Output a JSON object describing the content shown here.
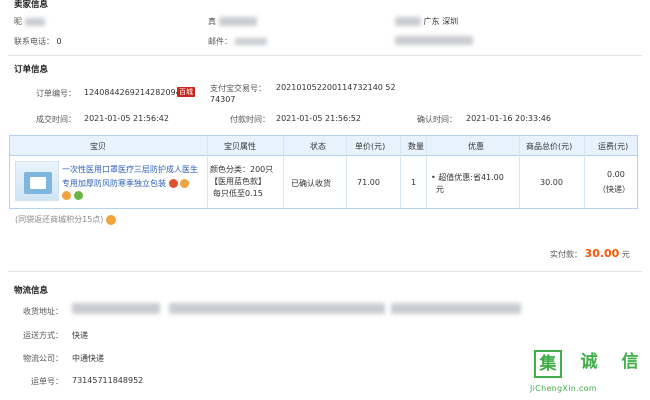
{
  "seller_info": {
    "title": "卖家信息",
    "row1_prefix": "昵",
    "row1_mid_prefix": "真",
    "row1_right_tail": "广东 深圳",
    "phone_label": "联系电话：",
    "phone_tail": "0",
    "email_label": "邮件："
  },
  "order_info": {
    "title": "订单信息",
    "order_no_label": "订单编号：",
    "order_no": "1240844269214282094",
    "order_badge": "百城",
    "alipay_label": "支付宝交易号：",
    "alipay_no_line1": "202101052200114732140 52",
    "alipay_no_line2": "74307",
    "created_label": "成交时间：",
    "created_time": "2021-01-05 21:56:42",
    "paid_label": "付款时间：",
    "paid_time": "2021-01-05 21:56:52",
    "confirm_label": "确认时间：",
    "confirm_time": "2021-01-16 20:33:46"
  },
  "order_table": {
    "headers": [
      "宝贝",
      "宝贝属性",
      "状态",
      "单价(元)",
      "数量",
      "优惠",
      "商品总价(元)",
      "运费(元)"
    ],
    "item": {
      "name_line1": "一次性医用口罩医疗三层防护成人医生",
      "name_line2": "专用加厚防风防寒季独立包装",
      "attr_line1": "颜色分类：200只",
      "attr_line2": "【医用蓝色款】",
      "attr_line3": "每只低至0.15",
      "status": "已确认收货",
      "unit_price": "71.00",
      "quantity": "1",
      "discount_line1": "• 超值优惠:省41.00",
      "discount_line2": "元",
      "total": "30.00",
      "shipping": "0.00",
      "shipping_method": "（快递）"
    }
  },
  "points_note": "(同袋返还商城积分15点)",
  "payment": {
    "label": "实付款：",
    "amount": "30.00",
    "unit": "元"
  },
  "logistics": {
    "title": "物流信息",
    "address_label": "收货地址：",
    "ship_method_label": "运送方式：",
    "ship_method": "快递",
    "company_label": "物流公司：",
    "company": "中通快递",
    "tracking_label": "运单号：",
    "tracking_no": "73145711848952"
  },
  "watermark": {
    "char1": "集",
    "char2": "诚",
    "char3": "信",
    "domain": "JiChengXin.com"
  },
  "colors": {
    "table_border": "#b6d2ee",
    "table_header_bg": "#e8f2fd",
    "price_accent": "#ff5500",
    "link_blue": "#2c5fb5",
    "watermark_green": "#3fae49"
  }
}
